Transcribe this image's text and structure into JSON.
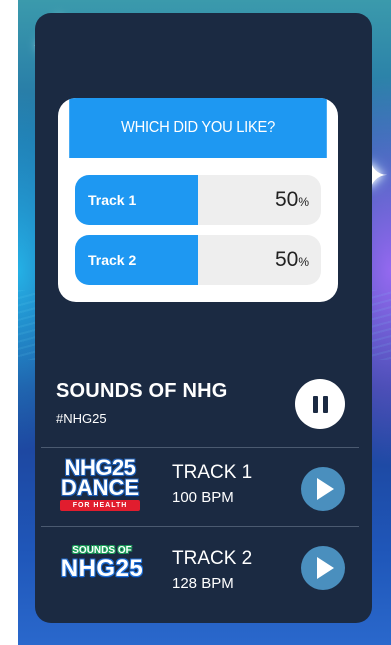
{
  "poll": {
    "question": "WHICH DID YOU LIKE?",
    "options": [
      {
        "label": "Track 1",
        "percent": "50",
        "unit": "%",
        "fraction": 0.5
      },
      {
        "label": "Track 2",
        "percent": "50",
        "unit": "%",
        "fraction": 0.5
      }
    ]
  },
  "now_playing": {
    "title": "SOUNDS OF NHG",
    "hashtag": "#NHG25"
  },
  "logos": {
    "dance": {
      "line1": "NHG25",
      "line2": "DANCE",
      "line3": "FOR HEALTH"
    },
    "sounds": {
      "line1": "SOUNDS OF",
      "line2": "NHG25"
    }
  },
  "tracks": [
    {
      "name": "TRACK 1",
      "bpm": "100 BPM"
    },
    {
      "name": "TRACK 2",
      "bpm": "128 BPM"
    }
  ],
  "icons": {
    "pause": "pause-icon",
    "play": "play-icon",
    "sparkle": "sparkle-icon"
  },
  "colors": {
    "accent": "#1e98f2",
    "card": "#1b2a42",
    "play_button": "#4a8fbe"
  }
}
